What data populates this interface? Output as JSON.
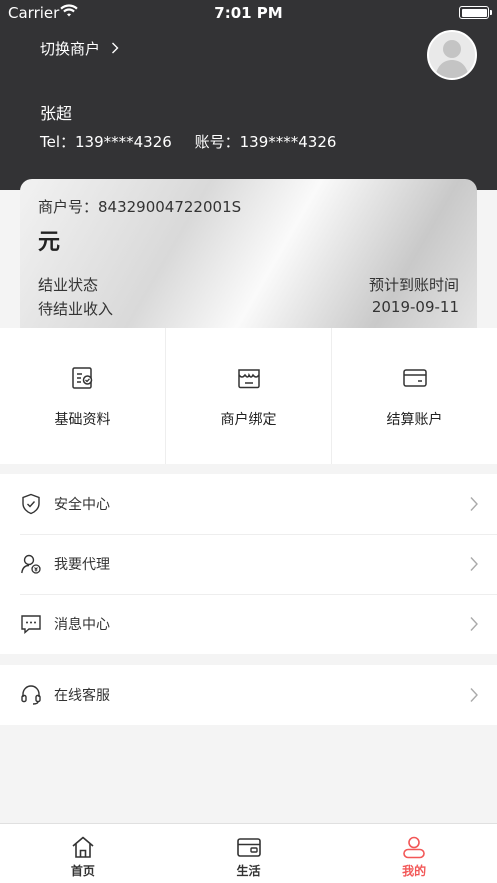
{
  "status_bar": {
    "carrier": "Carrier",
    "time": "7:01 PM"
  },
  "header": {
    "switch_merchant": "切换商户",
    "user_name": "张超",
    "tel": "Tel：139****4326",
    "account": "账号：139****4326",
    "avatar_icon": "default-avatar-icon"
  },
  "card": {
    "merchant_no": "商户号：84329004722001S",
    "amount_unit": "元",
    "status_label": "结业状态",
    "expected_label": "预计到账时间",
    "pending_label": "待结业收入",
    "expected_date": "2019-09-11"
  },
  "grid": [
    {
      "label": "基础资料",
      "icon": "profile-certificate-icon"
    },
    {
      "label": "商户绑定",
      "icon": "store-icon"
    },
    {
      "label": "结算账户",
      "icon": "bank-card-icon"
    }
  ],
  "menu_group1": [
    {
      "label": "安全中心",
      "icon": "shield-icon"
    },
    {
      "label": "我要代理",
      "icon": "agent-user-icon"
    },
    {
      "label": "消息中心",
      "icon": "message-icon"
    }
  ],
  "menu_group2": [
    {
      "label": "在线客服",
      "icon": "headset-icon"
    }
  ],
  "tabbar": [
    {
      "label": "首页",
      "icon": "home-icon",
      "active": false
    },
    {
      "label": "生活",
      "icon": "wallet-card-icon",
      "active": false
    },
    {
      "label": "我的",
      "icon": "user-icon",
      "active": true
    }
  ],
  "colors": {
    "header_bg": "#333335",
    "accent": "#f25757",
    "page_bg": "#f4f4f4"
  }
}
